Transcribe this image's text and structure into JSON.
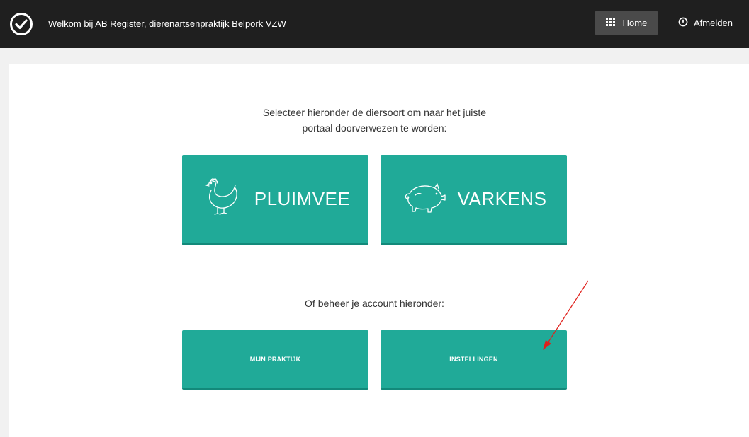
{
  "header": {
    "welcome_text": "Welkom bij AB Register, dierenartsenpraktijk Belpork VZW",
    "home_label": "Home",
    "logout_label": "Afmelden",
    "bg_color": "#1f1f1f"
  },
  "main": {
    "intro_line1": "Selecteer hieronder de diersoort om naar het juiste",
    "intro_line2": "portaal doorverwezen te worden:",
    "species": [
      {
        "label": "PLUIMVEE",
        "icon": "chicken-icon"
      },
      {
        "label": "VARKENS",
        "icon": "pig-icon"
      }
    ],
    "account_title": "Of beheer je account hieronder:",
    "account_buttons": [
      {
        "label": "MIJN PRAKTIJK"
      },
      {
        "label": "INSTELLINGEN"
      }
    ],
    "accent_color": "#20aa98"
  },
  "annotation": {
    "arrow_color": "#e0201b"
  }
}
